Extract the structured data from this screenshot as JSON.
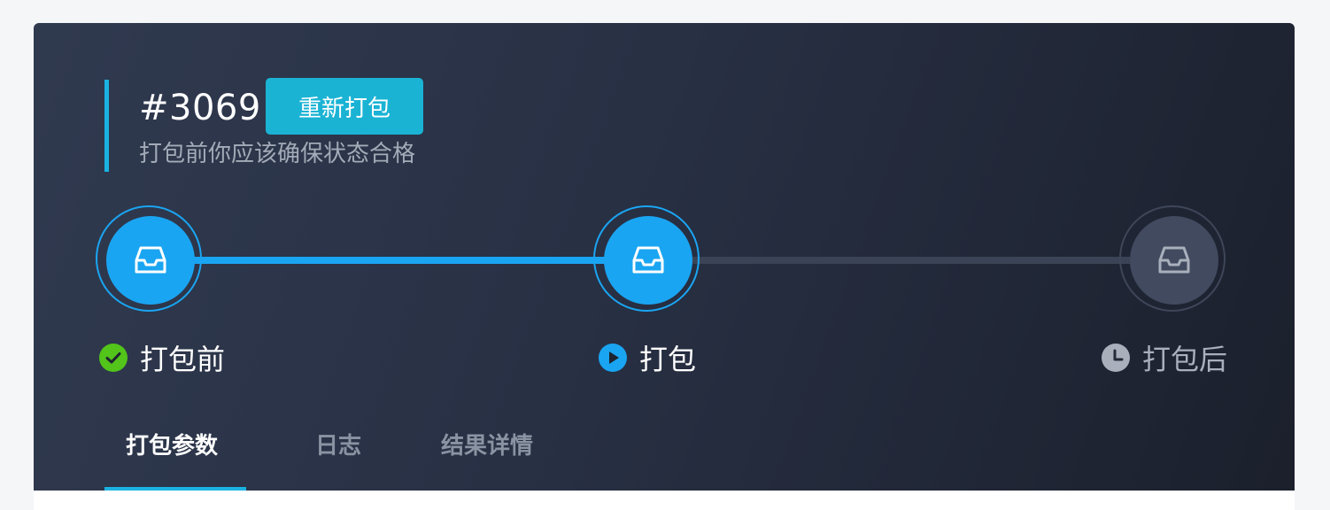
{
  "header": {
    "build_id": "#3069",
    "rebuild_label": "重新打包",
    "subtitle": "打包前你应该确保状态合格"
  },
  "steps": [
    {
      "label": "打包前",
      "status": "completed",
      "icon": "inbox-icon",
      "status_icon": "check-circle-icon"
    },
    {
      "label": "打包",
      "status": "running",
      "icon": "inbox-icon",
      "status_icon": "play-circle-icon"
    },
    {
      "label": "打包后",
      "status": "waiting",
      "icon": "inbox-icon",
      "status_icon": "clock-icon"
    }
  ],
  "tabs": [
    {
      "label": "打包参数",
      "active": true
    },
    {
      "label": "日志",
      "active": false
    },
    {
      "label": "结果详情",
      "active": false
    }
  ],
  "colors": {
    "accent": "#1ab3e2",
    "step_active": "#1aa5f2",
    "success": "#52c41a",
    "pending": "#414a5f"
  }
}
